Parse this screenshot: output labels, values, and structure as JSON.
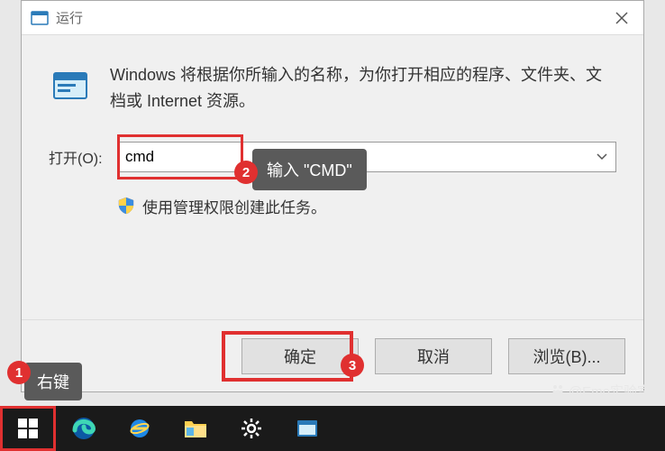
{
  "dialog": {
    "title": "运行",
    "description": "Windows 将根据你所输入的名称，为你打开相应的程序、文件夹、文档或 Internet 资源。",
    "open_label": "打开(O):",
    "open_value": "cmd",
    "admin_text": "使用管理权限创建此任务。",
    "ok_label": "确定",
    "cancel_label": "取消",
    "browse_label": "浏览(B)..."
  },
  "callouts": {
    "rightclick": "右键",
    "input_cmd": "输入 \"CMD\""
  },
  "badges": {
    "b1": "1",
    "b2": "2",
    "b3": "3"
  },
  "watermark": "@Emo实验室"
}
